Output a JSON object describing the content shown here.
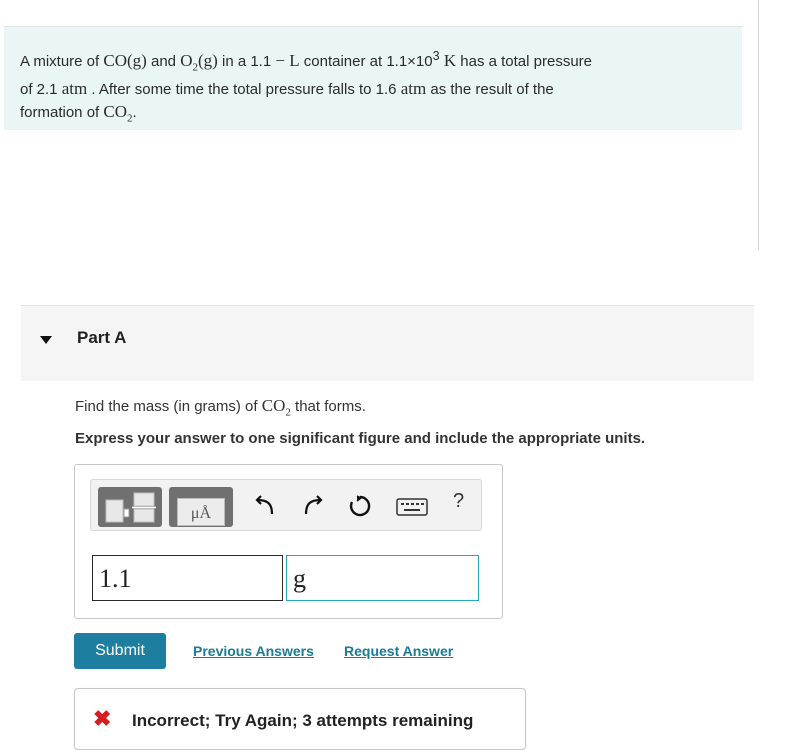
{
  "problem": {
    "line1": {
      "prefix": "A mixture of ",
      "species1": "CO(g)",
      "and": " and ",
      "species2_base": "O",
      "species2_sub": "2",
      "species2_phase": "(g)",
      "container_pre": " in a 1.1 ",
      "container_unit": "− L",
      "container_post": " container at 1.1×10",
      "temp_exp": "3",
      "temp_unit": " K",
      "tail": " has a total pressure"
    },
    "line2": {
      "prefix": "of 2.1 ",
      "unit1": "atm",
      "mid": " . After some time the total pressure falls to 1.6 ",
      "unit2": "atm",
      "tail": " as the result of the"
    },
    "line3": {
      "prefix": "formation of ",
      "product_base": "CO",
      "product_sub": "2",
      "tail": "."
    }
  },
  "part": {
    "title": "Part A"
  },
  "question": {
    "prefix": "Find the mass (in grams) of ",
    "species_base": "CO",
    "species_sub": "2",
    "tail": " that forms."
  },
  "instructions": "Express your answer to one significant figure and include the appropriate units.",
  "toolbar": {
    "units_label": "μÅ",
    "help_label": "?"
  },
  "answer": {
    "value": "1.1",
    "units": "g"
  },
  "actions": {
    "submit_label": "Submit",
    "previous_label": "Previous Answers",
    "request_label": "Request Answer"
  },
  "feedback": {
    "icon": "✖",
    "text": "Incorrect; Try Again; 3 attempts remaining",
    "color": "#d21f1f"
  },
  "colors": {
    "problem_bg": "#e9f6f5",
    "submit_bg": "#1d7ea0",
    "link": "#1b7a94",
    "units_border": "#27a8b8"
  }
}
